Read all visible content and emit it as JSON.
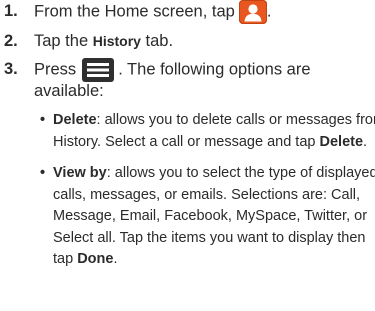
{
  "steps": [
    {
      "number": "1.",
      "text_before": "From the Home screen, tap",
      "icon": "contacts-icon",
      "text_after": "."
    },
    {
      "number": "2.",
      "text_before": "Tap the",
      "tab_name": "History",
      "text_after": "tab."
    },
    {
      "number": "3.",
      "text_before": "Press",
      "icon": "menu-key-icon",
      "text_after": ". The following options are",
      "text_cont": "available:"
    }
  ],
  "options": [
    {
      "term": "Delete",
      "lines": [
        ": allows you to delete calls or messages from",
        "History. Select a call or message and tap",
        "."
      ],
      "action": "Delete"
    },
    {
      "term": "View by",
      "lines": [
        ": allows you to select the type of displayed",
        "calls, messages, or emails. Selections are: Call,",
        "Message, Email, Facebook, MySpace, Twitter, or",
        "Select all. Tap the items you want to display then",
        "tap",
        "."
      ],
      "action": "Done"
    }
  ],
  "colors": {
    "text": "#2b2b2b",
    "contacts_icon_bg": "#e8571f",
    "menu_icon_bg": "#2f2f2f"
  }
}
